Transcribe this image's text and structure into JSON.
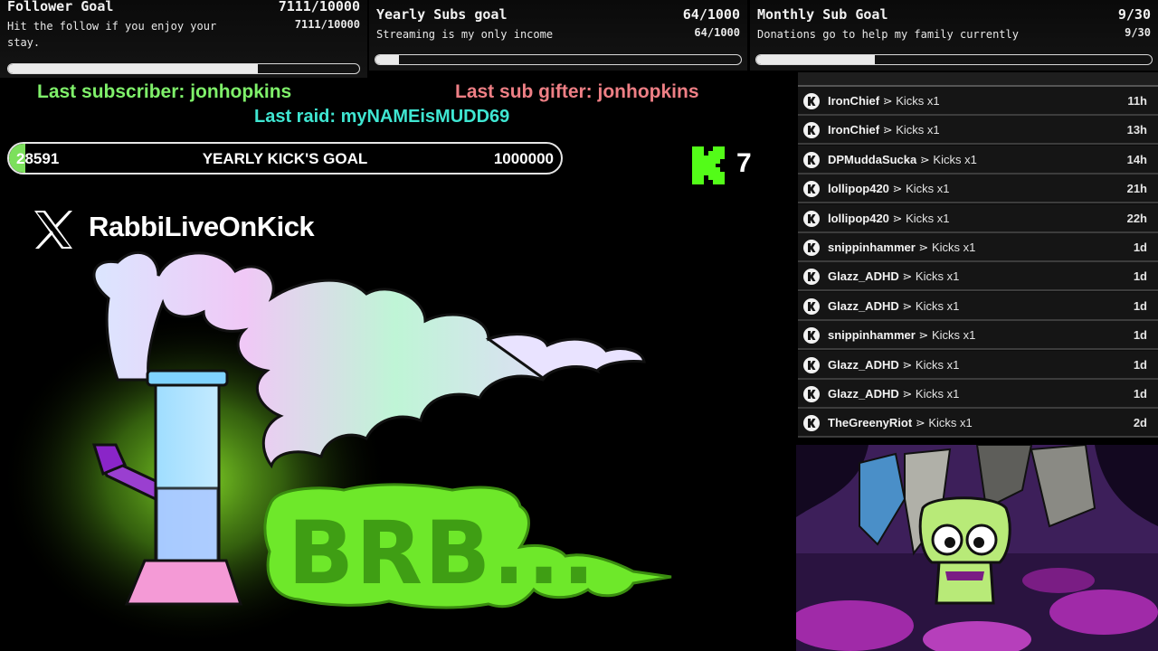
{
  "goals": {
    "follower": {
      "title": "Follower Goal",
      "count": "7111/10000",
      "description": "Hit the follow if you enjoy your stay.",
      "progress": 0.711
    },
    "yearly_subs": {
      "title": "Yearly Subs goal",
      "count": "64/1000",
      "description": "Streaming is my only income",
      "progress": 0.064
    },
    "monthly_subs": {
      "title": "Monthly Sub Goal",
      "count": "9/30",
      "description": "Donations go to help my family currently",
      "progress": 0.3
    }
  },
  "last_events": {
    "subscriber": "Last subscriber: jonhopkins",
    "sub_gifter": "Last sub gifter: jonhopkins",
    "raid": "Last raid: myNAMEisMUDD69"
  },
  "kicks_goal": {
    "current": "28591",
    "label": "YEARLY KICK'S GOAL",
    "target": "1000000",
    "progress": 0.028591
  },
  "kick_counter": {
    "count": "7",
    "accent": "#53fc18"
  },
  "social": {
    "icon": "x-icon",
    "handle": "RabbiLiveOnKick"
  },
  "brb": {
    "text": "BRB...",
    "accent": "#6ee82a"
  },
  "feed": {
    "item_separator": "⋗",
    "rows": [
      {
        "user": "IronChief",
        "item": "Kicks x1",
        "time": "11h"
      },
      {
        "user": "IronChief",
        "item": "Kicks x1",
        "time": "13h"
      },
      {
        "user": "DPMuddaSucka",
        "item": "Kicks x1",
        "time": "14h"
      },
      {
        "user": "lollipop420",
        "item": "Kicks x1",
        "time": "21h"
      },
      {
        "user": "lollipop420",
        "item": "Kicks x1",
        "time": "22h"
      },
      {
        "user": "snippinhammer",
        "item": "Kicks x1",
        "time": "1d"
      },
      {
        "user": "Glazz_ADHD",
        "item": "Kicks x1",
        "time": "1d"
      },
      {
        "user": "Glazz_ADHD",
        "item": "Kicks x1",
        "time": "1d"
      },
      {
        "user": "snippinhammer",
        "item": "Kicks x1",
        "time": "1d"
      },
      {
        "user": "Glazz_ADHD",
        "item": "Kicks x1",
        "time": "1d"
      },
      {
        "user": "Glazz_ADHD",
        "item": "Kicks x1",
        "time": "1d"
      },
      {
        "user": "TheGreenyRiot",
        "item": "Kicks x1",
        "time": "2d"
      }
    ]
  }
}
